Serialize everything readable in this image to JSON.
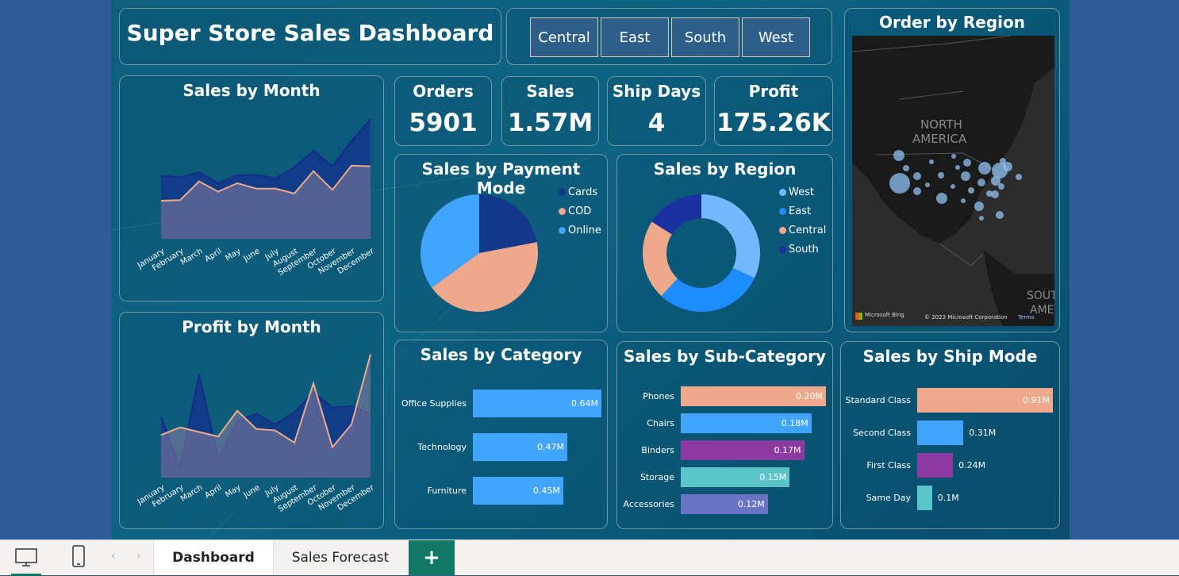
{
  "title": "Super Store Sales Dashboard",
  "slicers": [
    "Central",
    "East",
    "South",
    "West"
  ],
  "kpis": {
    "orders": {
      "label": "Orders",
      "value": "5901"
    },
    "sales": {
      "label": "Sales",
      "value": "1.57M"
    },
    "ship_days": {
      "label": "Ship Days",
      "value": "4"
    },
    "profit": {
      "label": "Profit",
      "value": "175.26K"
    }
  },
  "months": [
    "January",
    "February",
    "March",
    "April",
    "May",
    "June",
    "July",
    "August",
    "September",
    "October",
    "November",
    "December"
  ],
  "map": {
    "title": "Order by Region",
    "label_north": "NORTH",
    "label_america": "AMERICA",
    "label_south": "SOUT",
    "label_amer": "AMER",
    "bing": "Microsoft Bing",
    "copyright": "© 2023 Microsoft Corporation",
    "terms": "Terms"
  },
  "colors": {
    "navy": "#13378a",
    "peach": "#eea98c",
    "blue": "#41a4ff",
    "purple": "#8c3aa2",
    "teal": "#5ac4c8",
    "lavender": "#6b73c4",
    "lightblue": "#74b9ff",
    "midblue": "#1e8dff",
    "darkblue": "#1a2fa0"
  },
  "chart_data": [
    {
      "type": "area",
      "title": "Sales by Month",
      "categories": [
        "January",
        "February",
        "March",
        "April",
        "May",
        "June",
        "July",
        "August",
        "September",
        "October",
        "November",
        "December"
      ],
      "series": [
        {
          "name": "",
          "values": [
            104,
            102,
            110,
            92,
            105,
            106,
            100,
            118,
            146,
            120,
            162,
            198
          ]
        },
        {
          "name": "",
          "values": [
            63,
            64,
            95,
            78,
            92,
            83,
            83,
            75,
            112,
            81,
            121,
            120
          ]
        }
      ]
    },
    {
      "type": "area",
      "title": "Profit by Month",
      "categories": [
        "January",
        "February",
        "March",
        "April",
        "May",
        "June",
        "July",
        "August",
        "September",
        "October",
        "November",
        "December"
      ],
      "series": [
        {
          "name": "",
          "values": [
            20,
            -13,
            48,
            -8,
            17,
            22,
            15,
            23,
            36,
            26,
            27,
            22
          ]
        },
        {
          "name": "",
          "values": [
            8,
            13,
            10,
            7,
            24,
            12,
            11,
            3,
            42,
            0,
            15,
            61
          ]
        }
      ]
    },
    {
      "type": "pie",
      "title": "Sales by Payment Mode",
      "categories": [
        "Cards",
        "COD",
        "Online"
      ],
      "values": [
        0.22,
        0.43,
        0.35
      ]
    },
    {
      "type": "pie",
      "title": "Sales by Region",
      "categories": [
        "West",
        "East",
        "Central",
        "South"
      ],
      "values": [
        0.32,
        0.3,
        0.22,
        0.16
      ]
    },
    {
      "type": "bar",
      "title": "Sales by Category",
      "categories": [
        "Office Supplies",
        "Technology",
        "Furniture"
      ],
      "values": [
        0.64,
        0.47,
        0.45
      ],
      "labels": [
        "0.64M",
        "0.47M",
        "0.45M"
      ]
    },
    {
      "type": "bar",
      "title": "Sales by Sub-Category",
      "categories": [
        "Phones",
        "Chairs",
        "Binders",
        "Storage",
        "Accessories"
      ],
      "values": [
        0.2,
        0.18,
        0.17,
        0.15,
        0.12
      ],
      "labels": [
        "0.20M",
        "0.18M",
        "0.17M",
        "0.15M",
        "0.12M"
      ]
    },
    {
      "type": "bar",
      "title": "Sales by Ship Mode",
      "categories": [
        "Standard Class",
        "Second Class",
        "First Class",
        "Same Day"
      ],
      "values": [
        0.91,
        0.31,
        0.24,
        0.1
      ],
      "labels": [
        "0.91M",
        "0.31M",
        "0.24M",
        "0.1M"
      ]
    }
  ],
  "bottom_tabs": {
    "dashboard": "Dashboard",
    "forecast": "Sales Forecast",
    "add": "+"
  }
}
